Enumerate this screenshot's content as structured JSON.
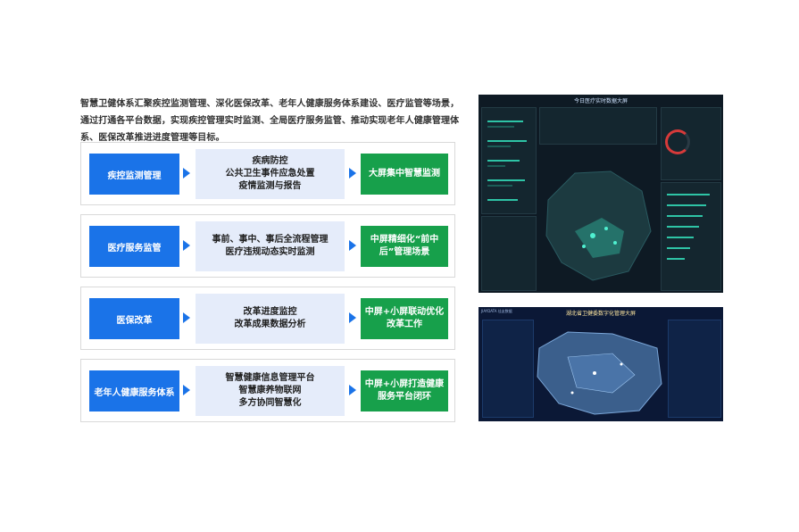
{
  "intro": "智慧卫健体系汇聚疾控监测管理、深化医保改革、老年人健康服务体系建设、医疗监管等场景，通过打通各平台数据，实现疾控管理实时监测、全局医疗服务监管、推动实现老年人健康管理体系、医保改革推进进度管理等目标。",
  "rows": [
    {
      "category": "疾控监测管理",
      "desc": [
        "疾病防控",
        "公共卫生事件应急处置",
        "疫情监测与报告"
      ],
      "result": "大屏集中智慧监测"
    },
    {
      "category": "医疗服务监管",
      "desc": [
        "事前、事中、事后全流程管理",
        "医疗违规动态实时监测"
      ],
      "result": "中屏精细化“前中后”管理场景"
    },
    {
      "category": "医保改革",
      "desc": [
        "改革进度监控",
        "改革成果数据分析"
      ],
      "result": "中屏+小屏联动优化改革工作"
    },
    {
      "category": "老年人健康服务体系",
      "desc": [
        "智慧健康信息管理平台",
        "智慧康养物联网",
        "多方协同智慧化"
      ],
      "result": "中屏+小屏打造健康服务平台闭环"
    }
  ],
  "screen1": {
    "title": "今日医疗实时数据大屏"
  },
  "screen2": {
    "title": "湖北省卫健委数字化管理大屏",
    "brand": "JIAYDATA 佳友数据"
  },
  "colors": {
    "blue": "#1a73e8",
    "light_blue": "#e5ecfa",
    "green": "#17a04b",
    "teal": "#2ec4a6"
  }
}
